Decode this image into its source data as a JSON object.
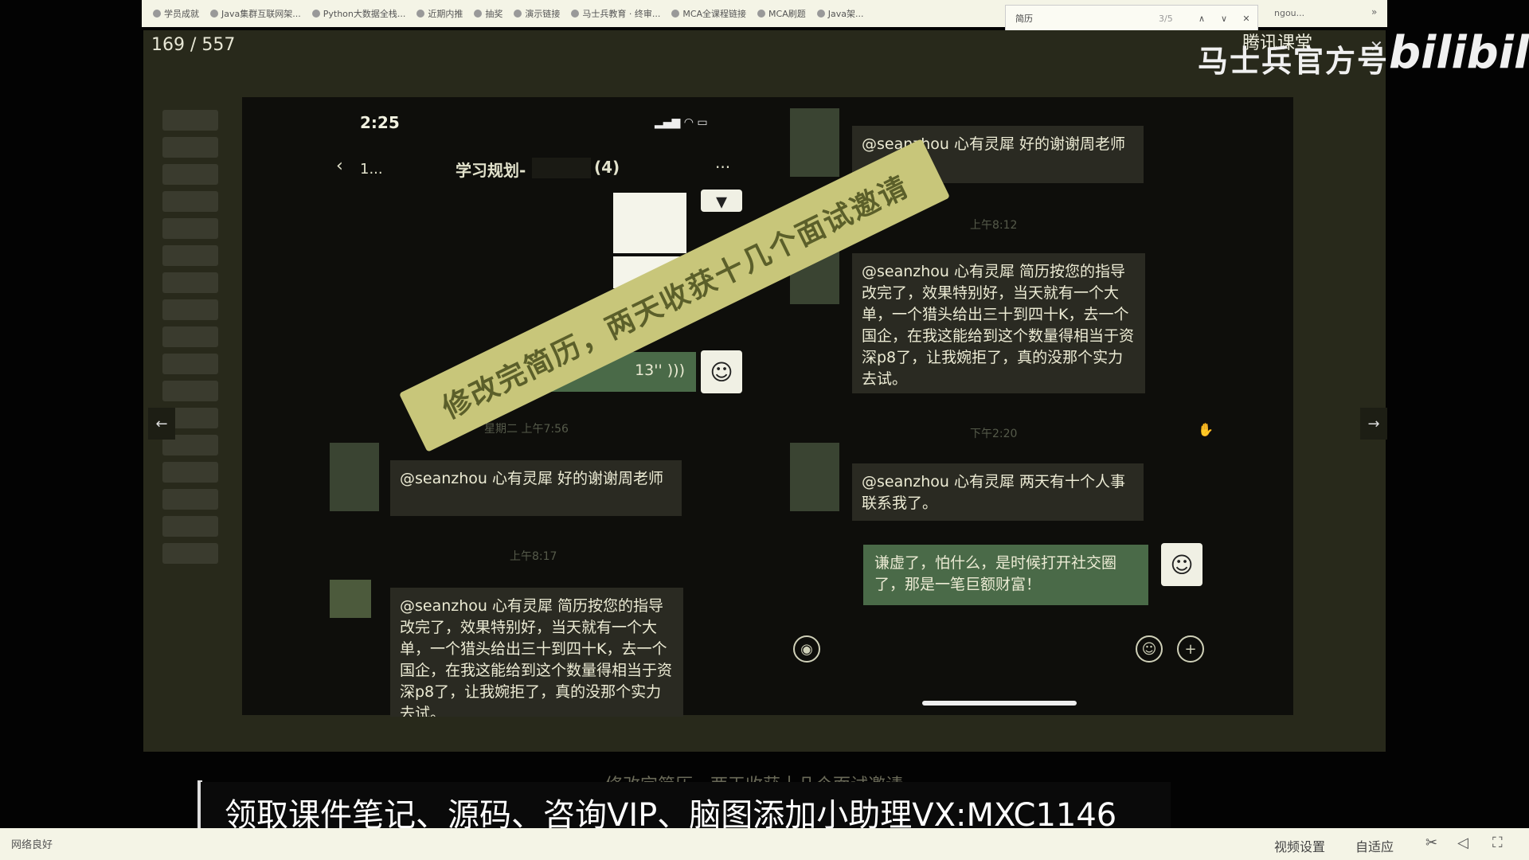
{
  "bookmarks": [
    "学员成就",
    "Java集群互联网架...",
    "Python大数据全栈...",
    "近期内推",
    "抽奖",
    "演示链接",
    "马士兵教育 · 终审...",
    "MCA全课程链接",
    "MCA刷题",
    "Java架..."
  ],
  "find_bar": {
    "query": "简历",
    "count": "3/5",
    "up": "∧",
    "down": "∨",
    "close": "✕"
  },
  "overflow_text": "ngou...",
  "overflow_chevron": "»",
  "page_counter": "169 / 557",
  "brand": "马士兵官方号",
  "bilibili": "bilibili",
  "tencent": "腾讯课堂",
  "tencent_close": "✕",
  "nav": {
    "prev": "←",
    "next": "→"
  },
  "phone": {
    "time": "2:25",
    "status": "▂▄▆ ◠ ▭",
    "back_label": "1...",
    "chat_title": "学习规划-",
    "member_count": "(4)",
    "more": "···"
  },
  "left_chat": {
    "voice_duration": "13''",
    "voice_icon": ")))",
    "ts1": "星期二 上午7:56",
    "msg1": "@seanzhou 心有灵犀 好的谢谢周老师",
    "ts2": "上午8:17",
    "msg2": "@seanzhou 心有灵犀 简历按您的指导改完了，效果特别好，当天就有一个大单，一个猎头给出三十到四十K，去一个国企，在我这能给到这个数量得相当于资深p8了，让我婉拒了，真的没那个实力去试。"
  },
  "right_chat": {
    "msg1": "@seanzhou 心有灵犀 好的谢谢周老师",
    "ts1": "上午8:12",
    "msg2": "@seanzhou 心有灵犀 简历按您的指导改完了，效果特别好，当天就有一个大单，一个猎头给出三十到四十K，去一个国企，在我这能给到这个数量得相当于资深p8了，让我婉拒了，真的没那个实力去试。",
    "ts2": "下午2:20",
    "msg3": "@seanzhou 心有灵犀 两天有十个人事联系我了。",
    "reply": "谦虚了，怕什么，是时候打开社交圈了，那是一笔巨额财富！",
    "voice_btn": "◉",
    "emoji_btn": "☺",
    "plus_btn": "+"
  },
  "banner": "修改完简历，两天收获十几个面试邀请",
  "subtitle_faint": "修改完简历，两天收获十几个面试邀请",
  "subtitle_main": "领取课件笔记、源码、咨询VIP、脑图添加小助理VX:MXC1146",
  "bottom": {
    "network": "网络良好",
    "video_settings": "视频设置",
    "adaptive": "自适应",
    "icons": [
      "mic-off-icon",
      "volume-icon",
      "fullscreen-icon"
    ]
  }
}
